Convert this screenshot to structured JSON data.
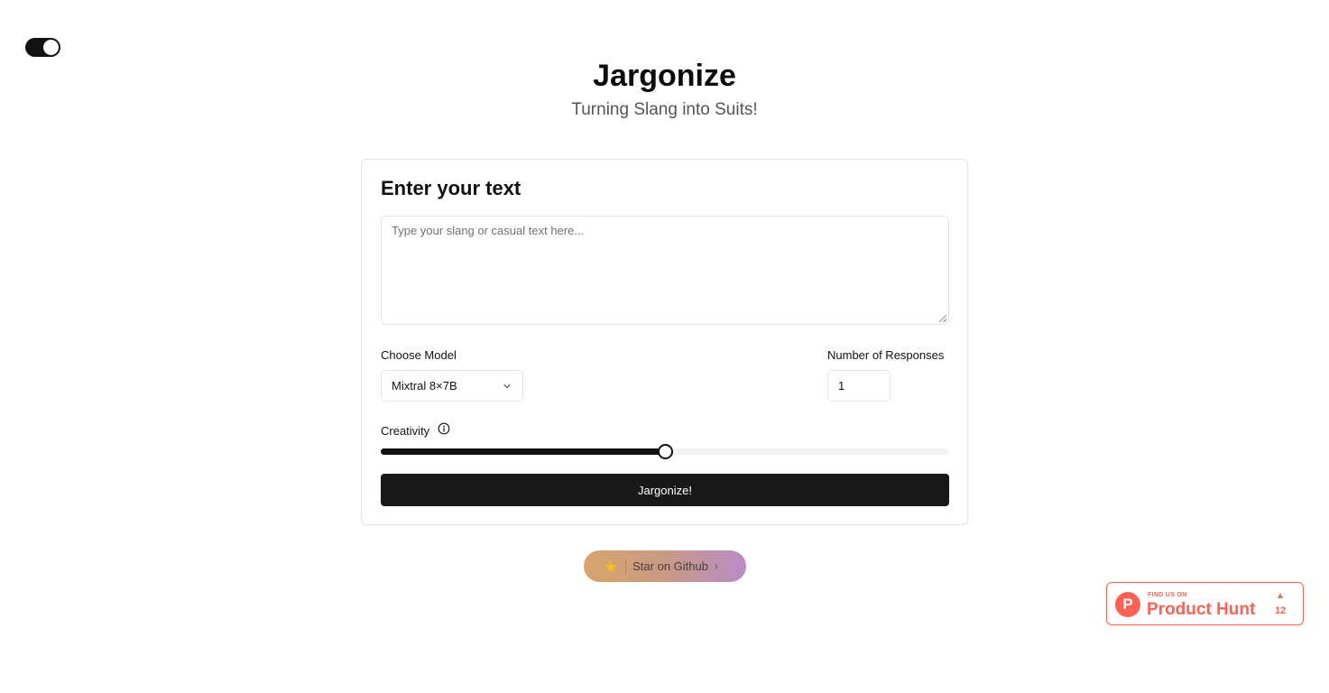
{
  "theme_toggle": {
    "state": "on"
  },
  "header": {
    "title": "Jargonize",
    "subtitle": "Turning Slang into Suits!"
  },
  "form": {
    "heading": "Enter your text",
    "text_input": {
      "value": "",
      "placeholder": "Type your slang or casual text here..."
    },
    "model": {
      "label": "Choose Model",
      "selected": "Mixtral 8×7B"
    },
    "responses": {
      "label": "Number of Responses",
      "value": "1"
    },
    "creativity": {
      "label": "Creativity",
      "value_fraction": 0.5
    },
    "submit_label": "Jargonize!"
  },
  "github": {
    "icon": "star-icon",
    "label": "Star on Github",
    "chevron": "›"
  },
  "product_hunt": {
    "small_text": "FIND US ON",
    "big_text": "Product Hunt",
    "logo_letter": "P",
    "upvote_arrow": "▲",
    "upvotes": "12",
    "brand_color": "#ff6154"
  },
  "colors": {
    "primary": "#18181b",
    "border": "#e4e4e7"
  }
}
